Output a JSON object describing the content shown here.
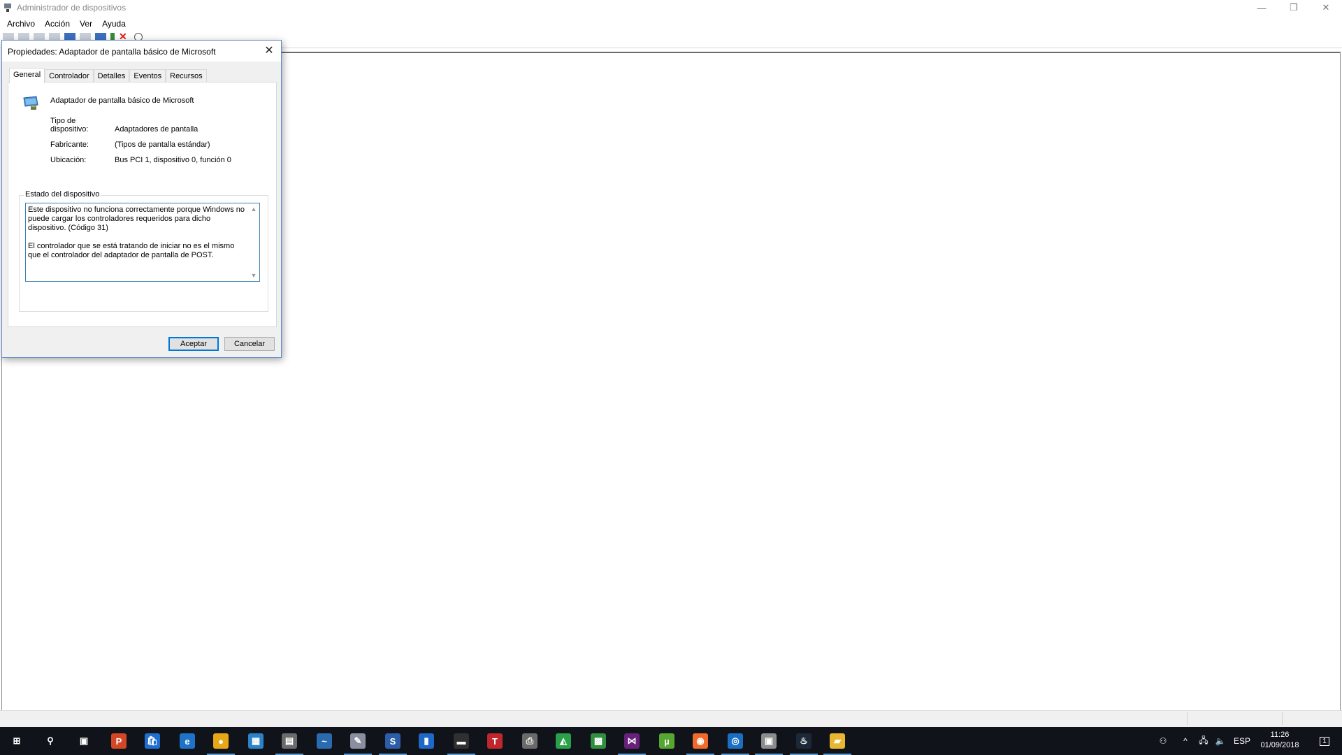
{
  "window": {
    "title": "Administrador de dispositivos",
    "controls": {
      "minimize": "—",
      "restore": "❐",
      "close": "✕"
    }
  },
  "menu": [
    "Archivo",
    "Acción",
    "Ver",
    "Ayuda"
  ],
  "dialog": {
    "title": "Propiedades: Adaptador de pantalla básico de Microsoft",
    "close_glyph": "✕",
    "tabs": [
      "General",
      "Controlador",
      "Detalles",
      "Eventos",
      "Recursos"
    ],
    "device_name": "Adaptador de pantalla básico de Microsoft",
    "properties": [
      {
        "label": "Tipo de\ndispositivo:",
        "value": "Adaptadores de pantalla"
      },
      {
        "label": "Fabricante:",
        "value": "(Tipos de pantalla estándar)"
      },
      {
        "label": "Ubicación:",
        "value": "Bus PCI 1, dispositivo 0, función 0"
      }
    ],
    "status_group_label": "Estado del dispositivo",
    "status_text": "Este dispositivo no funciona correctamente porque Windows no puede cargar los controladores requeridos para dicho dispositivo. (Código 31)\n\nEl controlador que se está tratando de iniciar no es el mismo que el controlador del adaptador de pantalla de POST.",
    "ok_label": "Aceptar",
    "cancel_label": "Cancelar"
  },
  "taskbar": {
    "apps": [
      {
        "name": "start",
        "glyph": "⊞",
        "color": "#10131a"
      },
      {
        "name": "search",
        "glyph": "⚲",
        "color": "#10131a"
      },
      {
        "name": "task-view",
        "glyph": "▣",
        "color": "#10131a"
      },
      {
        "name": "powerpoint",
        "glyph": "P",
        "color": "#d24726"
      },
      {
        "name": "store",
        "glyph": "🛍",
        "color": "#1f6fd0"
      },
      {
        "name": "edge",
        "glyph": "e",
        "color": "#1e73c8"
      },
      {
        "name": "chrome",
        "glyph": "●",
        "color": "#e6a817"
      },
      {
        "name": "control-panel",
        "glyph": "▦",
        "color": "#2b82c9"
      },
      {
        "name": "calculator",
        "glyph": "▤",
        "color": "#6b6b6b"
      },
      {
        "name": "dolphin",
        "glyph": "~",
        "color": "#2a6bb0"
      },
      {
        "name": "app-tool",
        "glyph": "✎",
        "color": "#8a8fa0"
      },
      {
        "name": "steam-like",
        "glyph": "S",
        "color": "#2b5da8"
      },
      {
        "name": "app-blue",
        "glyph": "▮",
        "color": "#1d68c8"
      },
      {
        "name": "app-dark",
        "glyph": "▬",
        "color": "#303030"
      },
      {
        "name": "app-t",
        "glyph": "T",
        "color": "#c0262d"
      },
      {
        "name": "printer",
        "glyph": "⎙",
        "color": "#6a6a6a"
      },
      {
        "name": "wifi-app",
        "glyph": "◭",
        "color": "#2aa04a"
      },
      {
        "name": "app-green",
        "glyph": "▩",
        "color": "#2f8f3f"
      },
      {
        "name": "visual-studio",
        "glyph": "⋈",
        "color": "#68217a"
      },
      {
        "name": "utorrent",
        "glyph": "µ",
        "color": "#56a632"
      },
      {
        "name": "origin",
        "glyph": "◉",
        "color": "#f06a2a"
      },
      {
        "name": "uplay",
        "glyph": "◎",
        "color": "#1b6fc2"
      },
      {
        "name": "app-box",
        "glyph": "▣",
        "color": "#8c8c8c"
      },
      {
        "name": "steam",
        "glyph": "♨",
        "color": "#1b2838"
      },
      {
        "name": "explorer",
        "glyph": "▰",
        "color": "#e8b630"
      }
    ],
    "tray": {
      "people": "⚇",
      "chevron": "^",
      "network": "🖧",
      "volume": "🔈",
      "lang": "ESP",
      "time": "11:26",
      "date": "01/09/2018",
      "notif": "1"
    }
  }
}
